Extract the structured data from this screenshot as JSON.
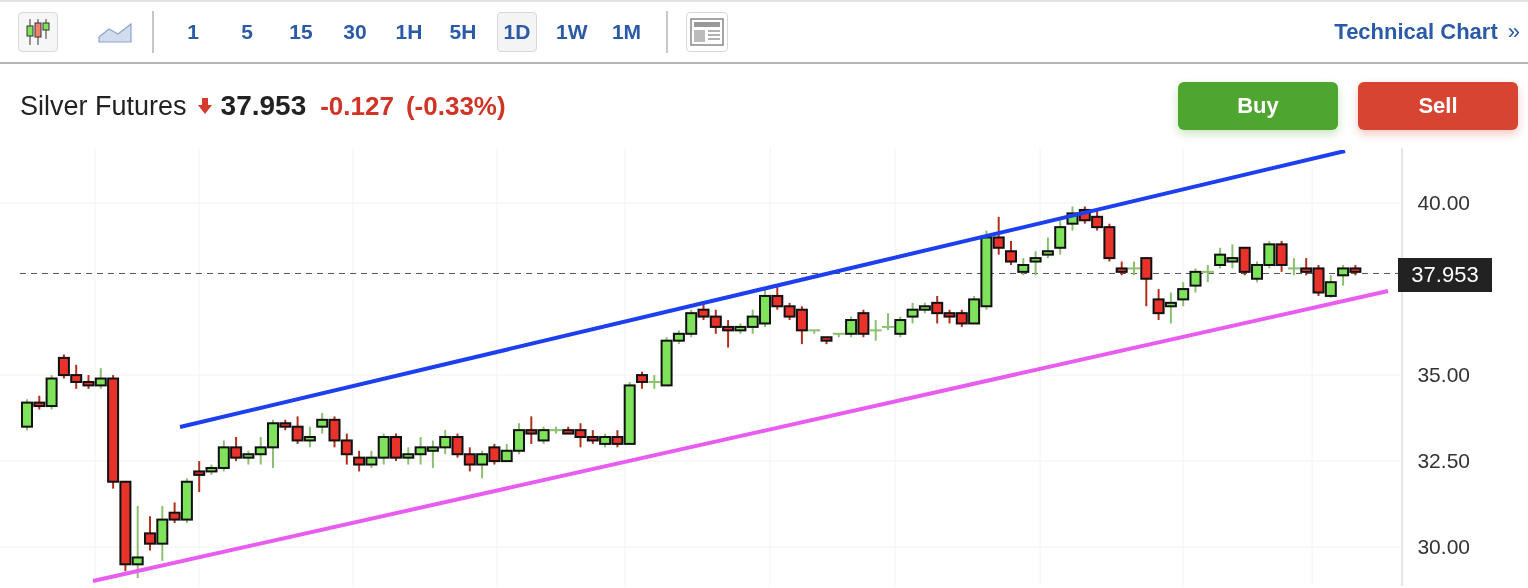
{
  "toolbar": {
    "chart_types": [
      {
        "kind": "candlestick",
        "selected": true
      },
      {
        "kind": "area",
        "selected": false
      }
    ],
    "intervals": [
      {
        "label": "1",
        "selected": false
      },
      {
        "label": "5",
        "selected": false
      },
      {
        "label": "15",
        "selected": false
      },
      {
        "label": "30",
        "selected": false
      },
      {
        "label": "1H",
        "selected": false
      },
      {
        "label": "5H",
        "selected": false
      },
      {
        "label": "1D",
        "selected": true
      },
      {
        "label": "1W",
        "selected": false
      },
      {
        "label": "1M",
        "selected": false
      }
    ],
    "link": {
      "label": "Technical Chart",
      "arrow": "»"
    }
  },
  "quote": {
    "name": "Silver Futures",
    "falling": true,
    "price": "37.953",
    "change": "-0.127",
    "change_percent": "(-0.33%)"
  },
  "actions": [
    {
      "kind": "buy",
      "label": "Buy"
    },
    {
      "kind": "sell",
      "label": "Sell"
    }
  ],
  "chart": {
    "chart_data": {
      "type": "candlestick",
      "ylim": [
        28.87,
        41.6
      ],
      "grid": true,
      "ref_lines": [
        {
          "axis": "y",
          "value": 37.953,
          "label": "37.953"
        }
      ],
      "yticks": [
        {
          "value": 30,
          "label": "30.00"
        },
        {
          "value": 32.5,
          "label": "32.50"
        },
        {
          "value": 35,
          "label": "35.00"
        },
        {
          "value": 40,
          "label": "40.00"
        }
      ],
      "ohlc": [
        [
          33.5,
          34.3,
          33.4,
          34.2
        ],
        [
          34.2,
          34.4,
          34.0,
          34.1
        ],
        [
          34.1,
          35.0,
          34.0,
          34.9
        ],
        [
          35.5,
          35.6,
          34.9,
          35.0
        ],
        [
          35.0,
          35.3,
          34.6,
          34.8
        ],
        [
          34.8,
          35.0,
          34.6,
          34.7
        ],
        [
          34.7,
          35.2,
          34.6,
          34.9
        ],
        [
          34.9,
          35.0,
          31.7,
          31.9
        ],
        [
          31.9,
          31.9,
          29.3,
          29.5
        ],
        [
          29.5,
          31.2,
          29.1,
          29.7
        ],
        [
          30.4,
          30.9,
          29.9,
          30.1
        ],
        [
          30.1,
          31.2,
          29.6,
          30.8
        ],
        [
          31.0,
          31.3,
          30.7,
          30.8
        ],
        [
          30.8,
          32.0,
          30.7,
          31.9
        ],
        [
          32.2,
          32.5,
          31.6,
          32.1
        ],
        [
          32.2,
          32.4,
          32.1,
          32.3
        ],
        [
          32.3,
          33.1,
          32.2,
          32.9
        ],
        [
          32.9,
          33.2,
          32.5,
          32.6
        ],
        [
          32.6,
          32.8,
          32.4,
          32.7
        ],
        [
          32.7,
          33.2,
          32.4,
          32.9
        ],
        [
          32.9,
          33.7,
          32.3,
          33.6
        ],
        [
          33.6,
          33.7,
          33.4,
          33.5
        ],
        [
          33.5,
          33.8,
          33.0,
          33.1
        ],
        [
          33.1,
          33.5,
          32.9,
          33.2
        ],
        [
          33.5,
          33.9,
          33.3,
          33.7
        ],
        [
          33.7,
          33.8,
          32.9,
          33.1
        ],
        [
          33.1,
          33.3,
          32.4,
          32.7
        ],
        [
          32.6,
          32.8,
          32.2,
          32.4
        ],
        [
          32.4,
          32.8,
          32.3,
          32.6
        ],
        [
          32.6,
          33.3,
          32.4,
          33.2
        ],
        [
          33.2,
          33.3,
          32.5,
          32.6
        ],
        [
          32.6,
          32.9,
          32.4,
          32.7
        ],
        [
          32.7,
          33.2,
          32.4,
          32.9
        ],
        [
          32.8,
          33.1,
          32.3,
          32.9
        ],
        [
          32.9,
          33.4,
          32.7,
          33.2
        ],
        [
          33.2,
          33.3,
          32.6,
          32.7
        ],
        [
          32.7,
          32.9,
          32.2,
          32.4
        ],
        [
          32.4,
          32.8,
          32.0,
          32.7
        ],
        [
          32.9,
          33.0,
          32.4,
          32.5
        ],
        [
          32.5,
          33.0,
          32.5,
          32.8
        ],
        [
          32.8,
          33.6,
          32.7,
          33.4
        ],
        [
          33.4,
          33.8,
          33.0,
          33.3
        ],
        [
          33.1,
          33.5,
          33.0,
          33.4
        ],
        [
          33.4,
          33.5,
          33.3,
          33.4
        ],
        [
          33.4,
          33.5,
          33.3,
          33.3
        ],
        [
          33.4,
          33.6,
          32.9,
          33.2
        ],
        [
          33.2,
          33.4,
          33.0,
          33.1
        ],
        [
          33.0,
          33.3,
          32.9,
          33.2
        ],
        [
          33.2,
          33.4,
          32.9,
          33.0
        ],
        [
          33.0,
          34.8,
          33.0,
          34.7
        ],
        [
          35.0,
          35.1,
          34.6,
          34.8
        ],
        [
          34.8,
          35.0,
          34.6,
          34.8
        ],
        [
          34.7,
          36.1,
          34.7,
          36.0
        ],
        [
          36.0,
          36.3,
          35.9,
          36.2
        ],
        [
          36.2,
          36.9,
          36.1,
          36.8
        ],
        [
          36.9,
          37.1,
          36.6,
          36.7
        ],
        [
          36.7,
          36.9,
          36.2,
          36.4
        ],
        [
          36.4,
          36.6,
          35.8,
          36.3
        ],
        [
          36.3,
          36.5,
          36.2,
          36.4
        ],
        [
          36.4,
          36.9,
          36.2,
          36.7
        ],
        [
          36.5,
          37.5,
          36.4,
          37.3
        ],
        [
          37.3,
          37.6,
          36.9,
          37.0
        ],
        [
          37.0,
          37.1,
          36.6,
          36.7
        ],
        [
          36.9,
          37.0,
          35.9,
          36.3
        ],
        [
          36.3,
          36.3,
          36.2,
          36.3
        ],
        [
          36.1,
          36.1,
          35.9,
          36.0
        ],
        [
          36.2,
          36.2,
          36.1,
          36.2
        ],
        [
          36.2,
          36.7,
          36.1,
          36.6
        ],
        [
          36.8,
          36.9,
          36.1,
          36.2
        ],
        [
          36.3,
          36.6,
          36.0,
          36.3
        ],
        [
          36.4,
          36.8,
          36.3,
          36.4
        ],
        [
          36.2,
          36.7,
          36.1,
          36.6
        ],
        [
          36.7,
          37.1,
          36.5,
          36.9
        ],
        [
          36.9,
          37.1,
          36.8,
          37.0
        ],
        [
          37.1,
          37.3,
          36.5,
          36.8
        ],
        [
          36.8,
          36.9,
          36.5,
          36.7
        ],
        [
          36.8,
          36.9,
          36.4,
          36.5
        ],
        [
          36.5,
          37.3,
          36.5,
          37.2
        ],
        [
          37.0,
          39.2,
          36.9,
          39.0
        ],
        [
          39.0,
          39.6,
          38.5,
          38.7
        ],
        [
          38.6,
          38.9,
          38.2,
          38.3
        ],
        [
          38.0,
          38.4,
          37.9,
          38.2
        ],
        [
          38.3,
          38.6,
          37.9,
          38.4
        ],
        [
          38.5,
          39.0,
          38.4,
          38.6
        ],
        [
          38.7,
          39.5,
          38.5,
          39.3
        ],
        [
          39.4,
          39.9,
          39.2,
          39.7
        ],
        [
          39.8,
          39.9,
          39.4,
          39.5
        ],
        [
          39.6,
          39.8,
          39.2,
          39.3
        ],
        [
          39.3,
          39.4,
          38.3,
          38.4
        ],
        [
          38.1,
          38.3,
          37.9,
          38.0
        ],
        [
          38.1,
          38.3,
          37.9,
          38.1
        ],
        [
          38.4,
          38.4,
          37.0,
          37.8
        ],
        [
          37.2,
          37.5,
          36.6,
          36.8
        ],
        [
          37.0,
          37.4,
          36.5,
          37.1
        ],
        [
          37.2,
          37.7,
          37.0,
          37.5
        ],
        [
          37.6,
          38.1,
          37.4,
          38.0
        ],
        [
          38.0,
          38.2,
          37.7,
          38.0
        ],
        [
          38.2,
          38.7,
          38.1,
          38.5
        ],
        [
          38.3,
          38.8,
          38.1,
          38.4
        ],
        [
          38.7,
          38.7,
          37.9,
          38.0
        ],
        [
          37.8,
          38.3,
          37.7,
          38.2
        ],
        [
          38.2,
          38.9,
          38.1,
          38.8
        ],
        [
          38.8,
          38.9,
          38.0,
          38.2
        ],
        [
          38.1,
          38.4,
          37.9,
          38.1
        ],
        [
          38.1,
          38.4,
          37.9,
          38.0
        ],
        [
          38.1,
          38.2,
          37.3,
          37.4
        ],
        [
          37.3,
          37.9,
          37.25,
          37.7
        ],
        [
          37.9,
          38.2,
          37.6,
          38.1
        ],
        [
          38.1,
          38.2,
          37.9,
          38.0
        ]
      ]
    }
  }
}
